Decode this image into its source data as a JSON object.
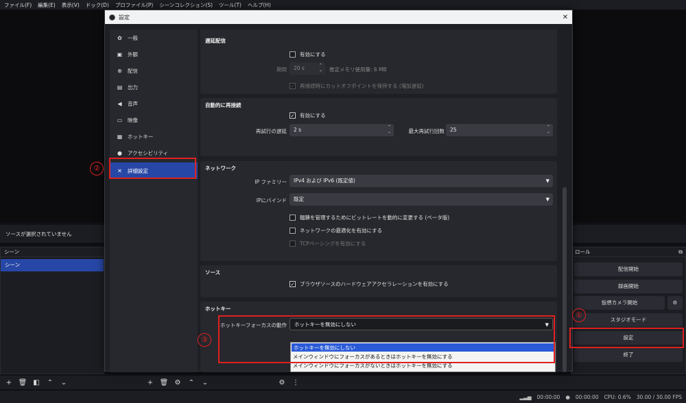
{
  "menubar": [
    "ファイル(F)",
    "編集(E)",
    "表示(V)",
    "ドック(D)",
    "プロファイル(P)",
    "シーンコレクション(S)",
    "ツール(T)",
    "ヘルプ(H)"
  ],
  "source_bar": {
    "text": "ソースが選択されていません"
  },
  "scenes": {
    "title": "シーン",
    "items": [
      "シーン"
    ]
  },
  "controls": {
    "title": "ロール",
    "buttons": [
      "配信開始",
      "録画開始",
      "仮想カメラ開始",
      "スタジオモード",
      "設定",
      "終了"
    ]
  },
  "statusbar": {
    "time1": "00:00:00",
    "time2": "00:00:00",
    "cpu": "CPU: 0.6%",
    "fps": "30.00 / 30.00 FPS"
  },
  "dialog": {
    "title": "設定",
    "nav": [
      {
        "icon": "gear-icon",
        "glyph": "✿",
        "label": "一般"
      },
      {
        "icon": "monitor-icon",
        "glyph": "▣",
        "label": "外観"
      },
      {
        "icon": "broadcast-icon",
        "glyph": "⊕",
        "label": "配信"
      },
      {
        "icon": "output-icon",
        "glyph": "▤",
        "label": "出力"
      },
      {
        "icon": "speaker-icon",
        "glyph": "◀",
        "label": "音声"
      },
      {
        "icon": "video-icon",
        "glyph": "▭",
        "label": "映像"
      },
      {
        "icon": "keyboard-icon",
        "glyph": "▦",
        "label": "ホットキー"
      },
      {
        "icon": "accessibility-icon",
        "glyph": "●",
        "label": "アクセシビリティ"
      },
      {
        "icon": "tools-icon",
        "glyph": "✕",
        "label": "詳細設定"
      }
    ],
    "delay": {
      "title": "遅延配信",
      "enable": "有効にする",
      "duration_label": "期間",
      "duration_value": "20 s",
      "memory": "推定メモリ使用量: 6 MB",
      "preserve": "再接続時にカットオフポイントを保持する (増加遅延)"
    },
    "reconnect": {
      "title": "自動的に再接続",
      "enable": "有効にする",
      "retry_delay_label": "再試行の遅延",
      "retry_delay_value": "2 s",
      "max_retries_label": "最大再試行回数",
      "max_retries_value": "25"
    },
    "network": {
      "title": "ネットワーク",
      "ip_family_label": "IP ファミリー",
      "ip_family_value": "IPv4 および IPv6 (既定値)",
      "bind_label": "IPにバインド",
      "bind_value": "既定",
      "dyn_bitrate": "輻輳を管理するためにビットレートを動的に変更する (ベータ版)",
      "net_opt": "ネットワークの最適化を有効にする",
      "tcp_pacing": "TCPペーシングを有効にする"
    },
    "sources": {
      "title": "ソース",
      "hw_accel": "ブラウザソースのハードウェアアクセラレーションを有効にする"
    },
    "hotkeys": {
      "title": "ホットキー",
      "focus_label": "ホットキーフォーカスの動作",
      "focus_value": "ホットキーを無効にしない",
      "options": [
        "ホットキーを無効にしない",
        "メインウィンドウにフォーカスがあるときはホットキーを無効にする",
        "メインウィンドウにフォーカスがないときはホットキーを無効にする"
      ]
    }
  },
  "annotations": {
    "one": "①",
    "two": "②",
    "three": "③"
  }
}
